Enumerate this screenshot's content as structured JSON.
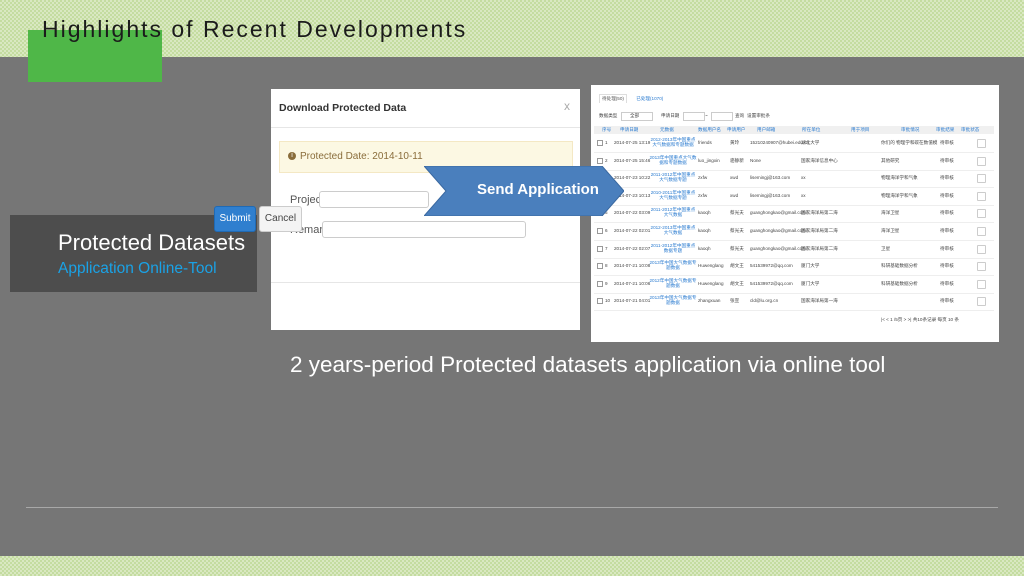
{
  "slide": {
    "title": "Highlights of Recent Developments",
    "left_title": "Protected Datasets",
    "left_subtitle": "Application  Online-Tool",
    "caption": "2 years-period Protected datasets application via online tool",
    "arrow_label": "Send Application"
  },
  "colors": {
    "accent_green": "#4fb748",
    "slide_bg": "#767676",
    "link_blue": "#1aa2e6",
    "arrow_blue": "#4a7fbd",
    "submit_blue": "#2f7fcf"
  },
  "dialog": {
    "title": "Download Protected Data",
    "close": "x",
    "alert_icon": "info-icon",
    "alert_text": "Protected Date: 2014-10-11",
    "project_label": "Project:",
    "remark_label": "Remark:",
    "submit": "Submit",
    "cancel": "Cancel"
  },
  "table": {
    "tabs": [
      "待处理(50)",
      "已处理(1070)"
    ],
    "filter": {
      "label1": "数据类型",
      "placeholder": "全部",
      "label2": "申请日期",
      "dash": "~",
      "query": "查询",
      "reset": "设置审批条"
    },
    "headers": [
      "序号",
      "申请日期",
      "元数据",
      "数据用户名",
      "申请用户",
      "用户邮箱",
      "所在单位",
      "用于项目",
      "审批情况",
      "审批结果",
      "审批状态"
    ],
    "rows": [
      {
        "n": "1",
        "date": "2014-07-25 13:19",
        "meta": "2012-2013年中国重点大气数据和专题数据",
        "user": "friends",
        "name": "黄玲",
        "email": "15210240907@hubei.edu.cn",
        "org": "湖北大学",
        "status": "你们的 物理学和碳在数值模",
        "result": "待审核"
      },
      {
        "n": "2",
        "date": "2014-07-25 15:46",
        "meta": "2013年中国重点大气数据和专题数据",
        "user": "luo_jingxin",
        "name": "骆静新",
        "email": "None",
        "org": "国家海洋信息中心",
        "status": "其他研究",
        "result": "待审核"
      },
      {
        "n": "3",
        "date": "2014-07-23 10:22",
        "meta": "2011-2012年中国重点大气数据专题",
        "user": "zxfw",
        "name": "xwd",
        "email": "lisemingj@163.com",
        "org": "xx",
        "status": "物理海洋学和气象",
        "result": "待审核"
      },
      {
        "n": "4",
        "date": "2014-07-23 10:13",
        "meta": "2010-2011年中国重点大气数据专题",
        "user": "zxfw",
        "name": "xwd",
        "email": "lisemingj@163.com",
        "org": "xx",
        "status": "物理海洋学和气象",
        "result": "待审核"
      },
      {
        "n": "5",
        "date": "2014-07-22 03:09",
        "meta": "2011-2012年中国重点大气数据",
        "user": "kaoqh",
        "name": "蔡光夫",
        "email": "guanghongkao@gmail.com",
        "org": "国家海洋局第二海",
        "status": "海洋卫星",
        "result": "待审核"
      },
      {
        "n": "6",
        "date": "2014-07-22 02:01",
        "meta": "2012-2013年中国重点大气数据",
        "user": "kaoqh",
        "name": "蔡光夫",
        "email": "guanghongkao@gmail.com",
        "org": "国家海洋局第二海",
        "status": "海洋卫星",
        "result": "待审核"
      },
      {
        "n": "7",
        "date": "2014-07-22 02:07",
        "meta": "2011-2012年中国重点数据专题",
        "user": "kaoqh",
        "name": "蔡光夫",
        "email": "guanghongkao@gmail.com",
        "org": "国家海洋局第二海",
        "status": "卫星",
        "result": "待审核"
      },
      {
        "n": "8",
        "date": "2014-07-21 10:08",
        "meta": "2013年中国大气数据专题数据",
        "user": "Huwenglang",
        "name": "胡文王",
        "email": "541539972@qq.com",
        "org": "厦门大学",
        "status": "科研基础数据分析",
        "result": "待审核"
      },
      {
        "n": "9",
        "date": "2014-07-21 10:06",
        "meta": "2012年中国大气数据专题数据",
        "user": "Huwenglang",
        "name": "胡文王",
        "email": "541539972@qq.com",
        "org": "厦门大学",
        "status": "科研基础数据分析",
        "result": "待审核"
      },
      {
        "n": "10",
        "date": "2014-07-21 04:01",
        "meta": "2013年中国大气数据专题数据",
        "user": "zhangxuan",
        "name": "张宣",
        "email": "cld@lu.org.cn",
        "org": "国家海洋局第一海",
        "status": "",
        "result": "待审核"
      }
    ],
    "pager": "|< < 1 /5页 > >| 共10条记录   每页 10 条"
  }
}
